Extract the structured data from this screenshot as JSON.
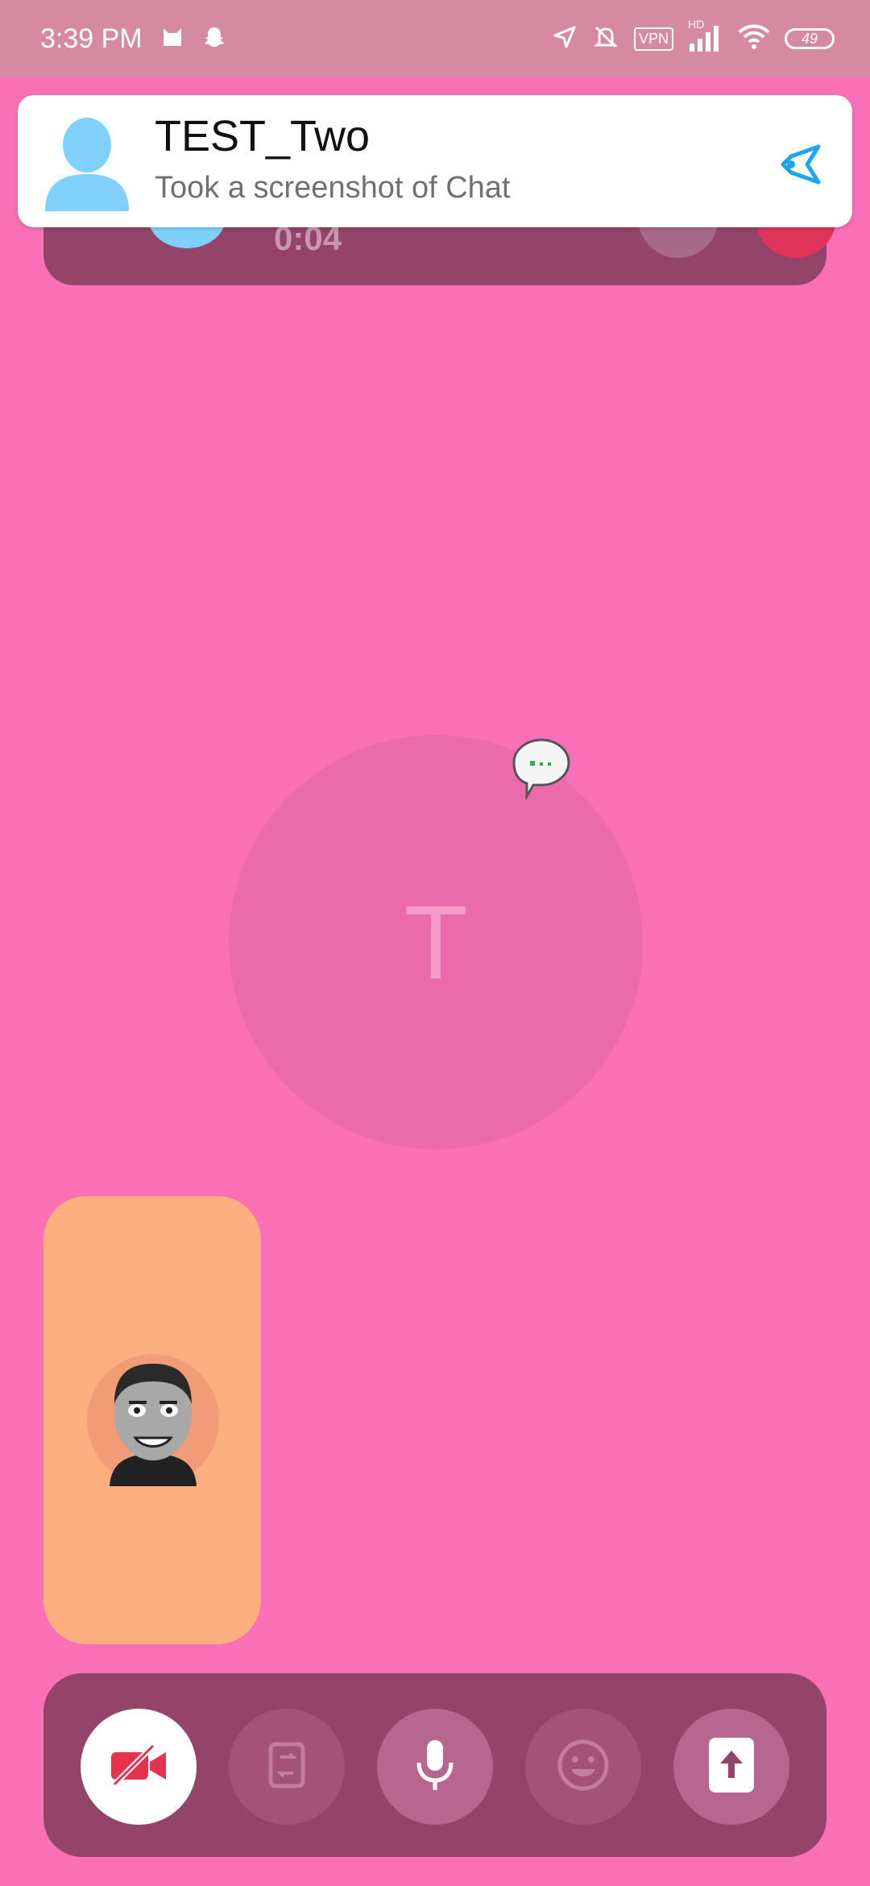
{
  "status_bar": {
    "time": "3:39 PM",
    "vpn": "VPN",
    "hd": "HD",
    "battery": "49",
    "icons": [
      "cat-icon",
      "snapchat-ghost-icon",
      "location-icon",
      "bell-muted-icon",
      "vpn-icon",
      "signal-icon",
      "wifi-icon",
      "battery-icon"
    ]
  },
  "notification": {
    "title": "TEST_Two",
    "subtitle": "Took a screenshot of Chat",
    "avatar_icon": "user-silhouette-icon",
    "action_icon": "snapchat-reply-icon",
    "colors": {
      "avatar": "#7FD1FC",
      "action": "#1FA5EF"
    }
  },
  "call": {
    "timer": "0:04"
  },
  "remote": {
    "initial": "T",
    "typing_icon": "typing-bubble-icon"
  },
  "local_preview": {
    "avatar_icon": "bitmoji-avatar"
  },
  "controls": [
    {
      "name": "video-off",
      "icon": "video-off-icon"
    },
    {
      "name": "flip-camera",
      "icon": "flip-camera-icon"
    },
    {
      "name": "microphone",
      "icon": "microphone-icon"
    },
    {
      "name": "lenses",
      "icon": "smiley-icon"
    },
    {
      "name": "share",
      "icon": "share-upload-icon"
    }
  ],
  "colors": {
    "background": "#F970B6",
    "status_bar": "#D58AA2",
    "bar": "#944469",
    "local_preview": "#FCAE7E",
    "end_call": "#E0355B",
    "video_off": "#E5334F"
  }
}
